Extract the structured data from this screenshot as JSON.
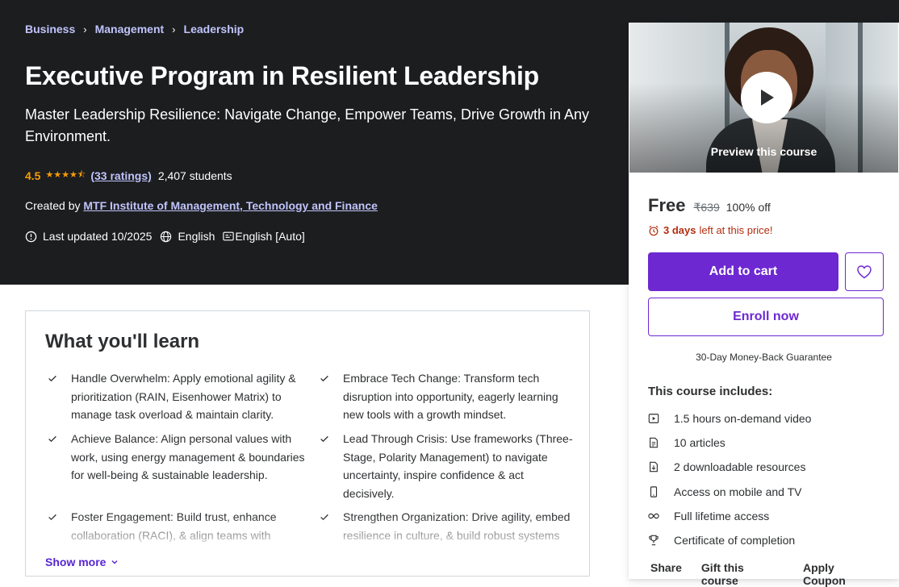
{
  "breadcrumb": [
    "Business",
    "Management",
    "Leadership"
  ],
  "course": {
    "title": "Executive Program in Resilient Leadership",
    "subtitle": "Master Leadership Resilience: Navigate Change, Empower Teams, Drive Growth in Any Environment.",
    "rating": "4.5",
    "rating_stars": 4.5,
    "ratings_count": "(33 ratings)",
    "students": "2,407 students",
    "created_by_label": "Created by",
    "instructor": "MTF Institute of Management, Technology and Finance",
    "last_updated": "Last updated 10/2025",
    "language": "English",
    "captions": "English [Auto]"
  },
  "learn": {
    "title": "What you'll learn",
    "items": [
      "Handle Overwhelm: Apply emotional agility & prioritization (RAIN, Eisenhower Matrix) to manage task overload & maintain clarity.",
      "Embrace Tech Change: Transform tech disruption into opportunity, eagerly learning new tools with a growth mindset.",
      "Achieve Balance: Align personal values with work, using energy management & boundaries for well-being & sustainable leadership.",
      "Lead Through Crisis: Use frameworks (Three-Stage, Polarity Management) to navigate uncertainty, inspire confidence & act decisively.",
      "Foster Engagement: Build trust, enhance collaboration (RACI), & align teams with",
      "Strengthen Organization: Drive agility, embed resilience in culture, & build robust systems"
    ],
    "show_more": "Show more"
  },
  "sidebar": {
    "preview_label": "Preview this course",
    "price": "Free",
    "original_price": "₹639",
    "discount": "100% off",
    "timer_bold": "3 days",
    "timer_rest": "left at this price!",
    "add_to_cart": "Add to cart",
    "enroll": "Enroll now",
    "guarantee": "30-Day Money-Back Guarantee",
    "includes_title": "This course includes:",
    "includes": [
      {
        "icon": "video-icon",
        "text": "1.5 hours on-demand video"
      },
      {
        "icon": "article-icon",
        "text": "10 articles"
      },
      {
        "icon": "download-icon",
        "text": "2 downloadable resources"
      },
      {
        "icon": "mobile-icon",
        "text": "Access on mobile and TV"
      },
      {
        "icon": "infinity-icon",
        "text": "Full lifetime access"
      },
      {
        "icon": "trophy-icon",
        "text": "Certificate of completion"
      }
    ],
    "footer": [
      "Share",
      "Gift this course",
      "Apply Coupon"
    ]
  },
  "colors": {
    "hero_bg": "#1c1d1f",
    "accent": "#6d28d2",
    "link_light": "#c0c4fc",
    "star": "#f69c08",
    "alert": "#b32d0f"
  }
}
